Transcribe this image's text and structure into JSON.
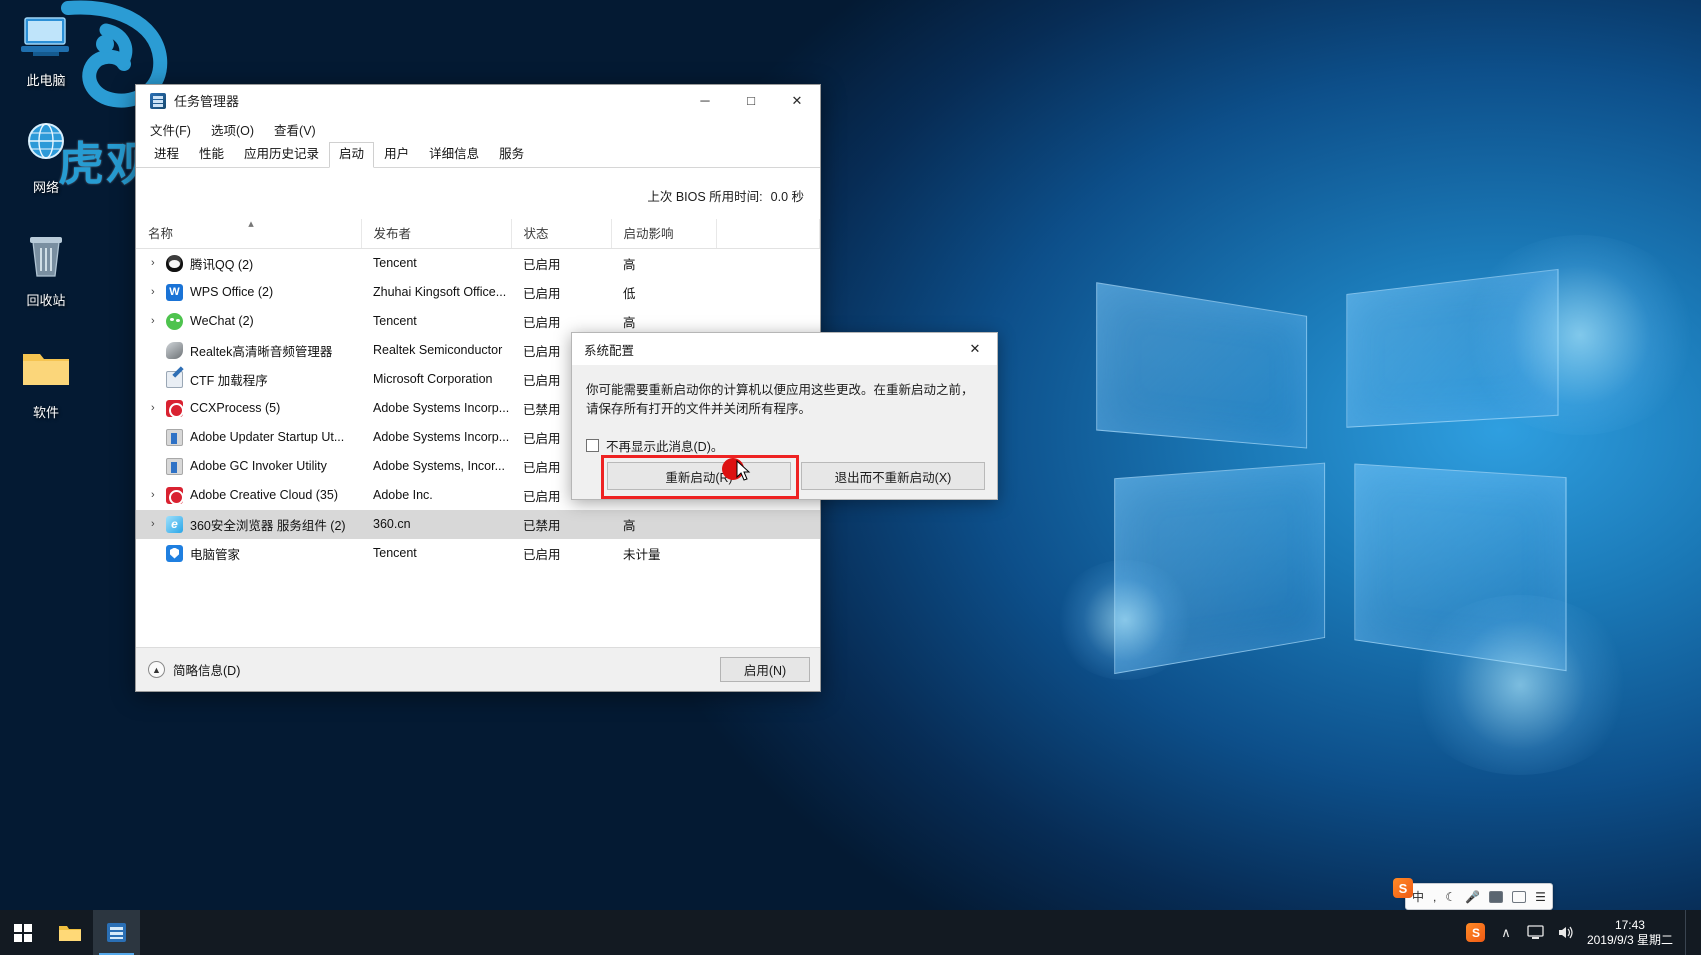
{
  "desktop": {
    "icons": [
      {
        "label": "此电脑",
        "icon": "this-pc-icon"
      },
      {
        "label": "网络",
        "icon": "network-icon"
      },
      {
        "label": "回收站",
        "icon": "recycle-bin-icon"
      },
      {
        "label": "软件",
        "icon": "folder-icon"
      }
    ],
    "watermark": "虎观"
  },
  "taskmanager": {
    "title": "任务管理器",
    "window_buttons": {
      "minimize": "─",
      "maximize": "□",
      "close": "✕"
    },
    "menu": [
      "文件(F)",
      "选项(O)",
      "查看(V)"
    ],
    "tabs": [
      {
        "label": "进程",
        "active": false
      },
      {
        "label": "性能",
        "active": false
      },
      {
        "label": "应用历史记录",
        "active": false
      },
      {
        "label": "启动",
        "active": true
      },
      {
        "label": "用户",
        "active": false
      },
      {
        "label": "详细信息",
        "active": false
      },
      {
        "label": "服务",
        "active": false
      }
    ],
    "bios_label": "上次 BIOS 所用时间:",
    "bios_value": "0.0 秒",
    "columns": [
      "名称",
      "发布者",
      "状态",
      "启动影响"
    ],
    "sorted_column": 0,
    "rows": [
      {
        "expandable": true,
        "icon": "qq-icon",
        "name": "腾讯QQ (2)",
        "publisher": "Tencent",
        "status": "已启用",
        "impact": "高",
        "selected": false
      },
      {
        "expandable": true,
        "icon": "wps-icon",
        "name": "WPS Office (2)",
        "publisher": "Zhuhai Kingsoft Office...",
        "status": "已启用",
        "impact": "低",
        "selected": false
      },
      {
        "expandable": true,
        "icon": "wechat-icon",
        "name": "WeChat (2)",
        "publisher": "Tencent",
        "status": "已启用",
        "impact": "高",
        "selected": false
      },
      {
        "expandable": false,
        "icon": "realtek-icon",
        "name": "Realtek高清晰音频管理器",
        "publisher": "Realtek Semiconductor",
        "status": "已启用",
        "impact": "",
        "selected": false
      },
      {
        "expandable": false,
        "icon": "ctf-icon",
        "name": "CTF 加载程序",
        "publisher": "Microsoft Corporation",
        "status": "已启用",
        "impact": "",
        "selected": false
      },
      {
        "expandable": true,
        "icon": "adobe-cc-icon",
        "name": "CCXProcess (5)",
        "publisher": "Adobe Systems Incorp...",
        "status": "已禁用",
        "impact": "",
        "selected": false
      },
      {
        "expandable": false,
        "icon": "adobe-gray-icon",
        "name": "Adobe Updater Startup Ut...",
        "publisher": "Adobe Systems Incorp...",
        "status": "已启用",
        "impact": "",
        "selected": false
      },
      {
        "expandable": false,
        "icon": "adobe-gray-icon",
        "name": "Adobe GC Invoker Utility",
        "publisher": "Adobe Systems, Incor...",
        "status": "已启用",
        "impact": "",
        "selected": false
      },
      {
        "expandable": true,
        "icon": "adobe-cc-icon",
        "name": "Adobe Creative Cloud (35)",
        "publisher": "Adobe Inc.",
        "status": "已启用",
        "impact": "",
        "selected": false
      },
      {
        "expandable": true,
        "icon": "browser-360-icon",
        "name": "360安全浏览器 服务组件 (2)",
        "publisher": "360.cn",
        "status": "已禁用",
        "impact": "高",
        "selected": true
      },
      {
        "expandable": false,
        "icon": "guanjia-icon",
        "name": "电脑管家",
        "publisher": "Tencent",
        "status": "已启用",
        "impact": "未计量",
        "selected": false
      }
    ],
    "footer": {
      "fewer_details": "简略信息(D)",
      "enable_button": "启用(N)"
    }
  },
  "sysconfig_dialog": {
    "title": "系统配置",
    "close": "✕",
    "message": "你可能需要重新启动你的计算机以便应用这些更改。在重新启动之前，请保存所有打开的文件并关闭所有程序。",
    "checkbox_label": "不再显示此消息(D)。",
    "restart_button": "重新启动(R)",
    "no_restart_button": "退出而不重新启动(X)",
    "highlight_color": "#ee2222",
    "cursor_color": "#dd1111"
  },
  "taskbar": {
    "start": "start-button",
    "apps": [
      {
        "name": "file-explorer",
        "active": false
      },
      {
        "name": "task-manager",
        "active": true
      }
    ],
    "tray": {
      "sogou": "S",
      "chevron": "∧",
      "monitor": "monitor-icon",
      "volume": "volume-icon",
      "time": "17:43",
      "date": "2019/9/3 星期二"
    }
  },
  "ime_bar": {
    "logo": "S",
    "mode": "中",
    "items": [
      "comma-icon",
      "moon-icon",
      "mic-icon",
      "keyboard-icon",
      "box-icon",
      "menu-icon"
    ]
  }
}
